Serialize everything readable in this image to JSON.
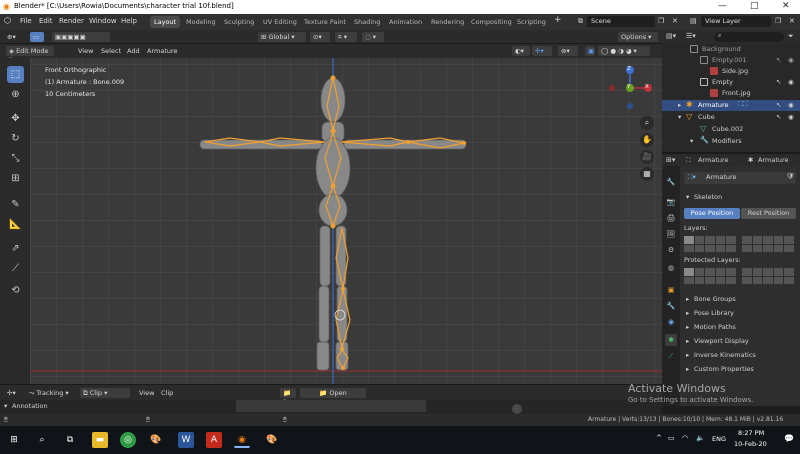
{
  "window": {
    "title": "Blender* [C:\\Users\\Rowia\\Documents\\character trial 10f.blend]",
    "controls": [
      "—",
      "□",
      "✕"
    ]
  },
  "menu": [
    "File",
    "Edit",
    "Render",
    "Window",
    "Help"
  ],
  "workspaces": [
    "Layout",
    "Modeling",
    "Sculpting",
    "UV Editing",
    "Texture Paint",
    "Shading",
    "Animation",
    "Rendering",
    "Compositing",
    "Scripting"
  ],
  "active_workspace": "Layout",
  "scene": "Scene",
  "view_layer": "View Layer",
  "viewport_header": {
    "mode": "Edit Mode",
    "menus": [
      "View",
      "Select",
      "Add",
      "Armature"
    ],
    "transform": "Global",
    "options": "Options"
  },
  "viewport": {
    "view_name": "Front Orthographic",
    "object_info": "(1) Armature : Bone.009",
    "scale": "10 Centimeters",
    "gizmo": {
      "z": "Z",
      "y": "Y",
      "x": "X"
    },
    "colors": {
      "bone": "#f0a030",
      "mesh": "#8a8a8a",
      "x_axis": "#c0303a",
      "y_axis": "#6aa020",
      "z_axis": "#3a70d8"
    }
  },
  "outliner": {
    "search_placeholder": "",
    "items": [
      {
        "label": "Background",
        "indent": 2,
        "icon": "empty-icon"
      },
      {
        "label": "Empty.001",
        "indent": 2,
        "icon": "empty-icon"
      },
      {
        "label": "Side.jpg",
        "indent": 3,
        "icon": "image-icon"
      },
      {
        "label": "Empty",
        "indent": 2,
        "icon": "empty-icon"
      },
      {
        "label": "Front.jpg",
        "indent": 3,
        "icon": "image-icon"
      },
      {
        "label": "Armature",
        "indent": 1,
        "icon": "armature-icon",
        "selected": true
      },
      {
        "label": "Cube",
        "indent": 1,
        "icon": "mesh-icon"
      },
      {
        "label": "Cube.002",
        "indent": 2,
        "icon": "mesh-data-icon"
      },
      {
        "label": "Modifiers",
        "indent": 2,
        "icon": "wrench-icon"
      }
    ]
  },
  "properties": {
    "header_left": "Armature",
    "header_right": "Armature",
    "data_name": "Armature",
    "skeleton": "Skeleton",
    "pose_position": "Pose Position",
    "rest_position": "Rest Position",
    "layers": "Layers:",
    "protected_layers": "Protected Layers:",
    "sections": [
      "Bone Groups",
      "Pose Library",
      "Motion Paths",
      "Viewport Display",
      "Inverse Kinematics",
      "Custom Properties"
    ]
  },
  "timeline": {
    "tracking": "Tracking",
    "clip": "Clip",
    "view": "View",
    "clip_menu": "Clip",
    "open": "Open",
    "annotation": "Annotation"
  },
  "status_bar": "Armature | Verts:13/13 | Bones:10/10 | Mem: 48.1 MiB | v2.81.16",
  "watermark": {
    "line1": "Activate Windows",
    "line2": "Go to Settings to activate Windows."
  },
  "taskbar": {
    "lang": "ENG",
    "time": "8:27 PM",
    "date": "10-Feb-20"
  }
}
